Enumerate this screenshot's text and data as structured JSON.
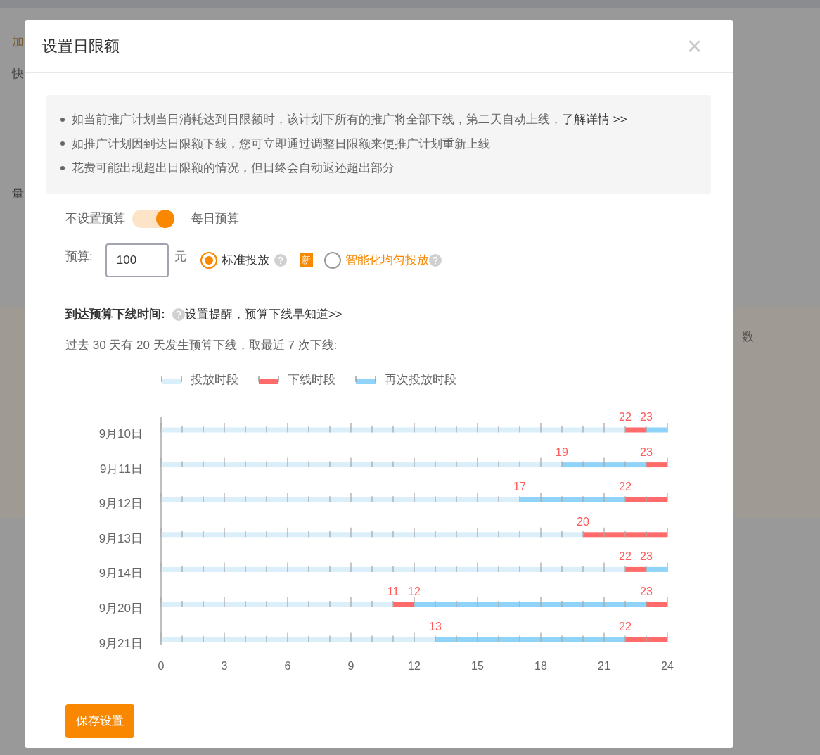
{
  "background": {
    "texts": [
      "加",
      "快",
      "量",
      "数"
    ]
  },
  "dialog": {
    "title": "设置日限额",
    "close": "×"
  },
  "notice": {
    "items": [
      {
        "text": "如当前推广计划当日消耗达到日限额时，该计划下所有的推广将全部下线，第二天自动上线，",
        "link": "了解详情 >>"
      },
      {
        "text": "如推广计划因到达日限额下线，您可立即通过调整日限额来使推广计划重新上线"
      },
      {
        "text": "花费可能出现超出日限额的情况，但日终会自动返还超出部分"
      }
    ]
  },
  "budget_switch": {
    "off_label": "不设置预算",
    "on_label": "每日预算",
    "on": true
  },
  "budget": {
    "label": "预算:",
    "value": "100",
    "unit": "元"
  },
  "delivery_options": [
    {
      "label": "标准投放",
      "selected": true,
      "highlight": false
    },
    {
      "label": "智能化均匀投放",
      "selected": false,
      "highlight": true,
      "badge": "新"
    }
  ],
  "offline_section": {
    "title": "到达预算下线时间:",
    "link": "设置提醒，预算下线早知道>>",
    "summary": "过去 30 天有 20 天发生预算下线，取最近 7 次下线:"
  },
  "chart_data": {
    "type": "bar",
    "orientation": "horizontal",
    "stacked": true,
    "legend": "top",
    "categories": [
      "9月10日",
      "9月11日",
      "9月12日",
      "9月13日",
      "9月14日",
      "9月20日",
      "9月21日"
    ],
    "series": [
      {
        "name": "投放时段",
        "color": "#dbeffb",
        "values": [
          22,
          19,
          17,
          20,
          22,
          11,
          13
        ]
      },
      {
        "name": "下线时段",
        "color": "#ff6b6b",
        "values": [
          1,
          null,
          null,
          4,
          1,
          1,
          null
        ]
      },
      {
        "name": "再次投放时段",
        "color": "#90d3f8",
        "values": [
          1,
          4,
          5,
          null,
          1,
          11,
          9
        ]
      },
      {
        "color": "#ff6b6b",
        "values": [
          null,
          1,
          2,
          null,
          null,
          1,
          2
        ]
      }
    ],
    "xlim": [
      0,
      24
    ],
    "xticks": [
      0,
      3,
      6,
      9,
      12,
      15,
      18,
      21,
      24
    ],
    "annotations": [
      {
        "y": "9月10日",
        "x": 22,
        "text": "22"
      },
      {
        "y": "9月10日",
        "x": 23,
        "text": "23"
      },
      {
        "y": "9月11日",
        "x": 19,
        "text": "19"
      },
      {
        "y": "9月11日",
        "x": 23,
        "text": "23"
      },
      {
        "y": "9月12日",
        "x": 17,
        "text": "17"
      },
      {
        "y": "9月12日",
        "x": 22,
        "text": "22"
      },
      {
        "y": "9月13日",
        "x": 20,
        "text": "20"
      },
      {
        "y": "9月14日",
        "x": 22,
        "text": "22"
      },
      {
        "y": "9月14日",
        "x": 23,
        "text": "23"
      },
      {
        "y": "9月20日",
        "x": 11,
        "text": "11"
      },
      {
        "y": "9月20日",
        "x": 12,
        "text": "12"
      },
      {
        "y": "9月20日",
        "x": 23,
        "text": "23"
      },
      {
        "y": "9月21日",
        "x": 13,
        "text": "13"
      },
      {
        "y": "9月21日",
        "x": 22,
        "text": "22"
      }
    ]
  },
  "save_button": "保存设置"
}
